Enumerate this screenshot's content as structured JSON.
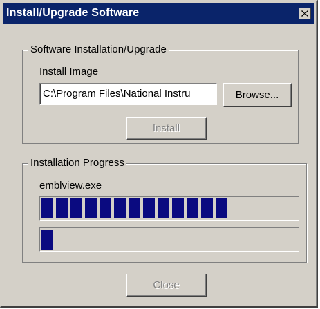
{
  "window": {
    "title": "Install/Upgrade Software"
  },
  "install_group": {
    "title": "Software Installation/Upgrade",
    "image_label": "Install Image",
    "image_path": "C:\\Program Files\\National Instru",
    "browse_label": "Browse...",
    "install_label": "Install"
  },
  "progress_group": {
    "title": "Installation Progress",
    "current_file": "emblview.exe",
    "file_progress": 0.7,
    "overall_progress": 0.05
  },
  "footer": {
    "close_label": "Close"
  },
  "colors": {
    "titlebar": "#0a246a",
    "progress_fill": "#0a0a80",
    "face": "#d4d0c8"
  }
}
